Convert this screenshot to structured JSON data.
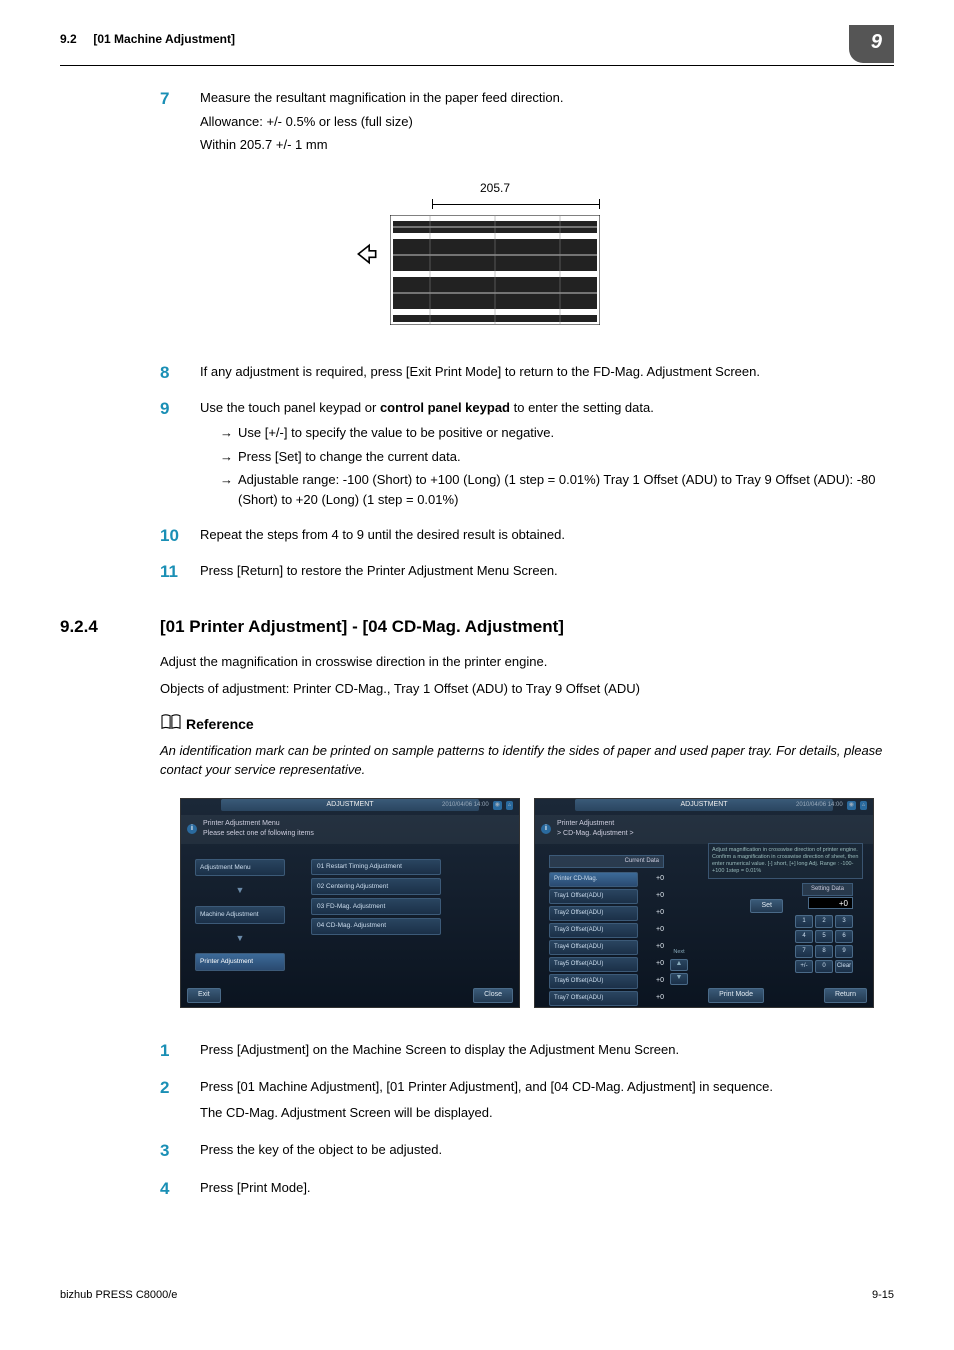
{
  "header": {
    "section": "9.2",
    "title": "[01 Machine Adjustment]",
    "chapter_badge": "9"
  },
  "steps_upper": {
    "s7": {
      "num": "7",
      "line1": "Measure the resultant magnification in the paper feed direction.",
      "line2": "Allowance: +/- 0.5% or less (full size)",
      "line3": "Within 205.7 +/- 1 mm"
    },
    "diagram_label": "205.7",
    "s8": {
      "num": "8",
      "text": "If any adjustment is required, press [Exit Print Mode] to return to the FD-Mag. Adjustment Screen."
    },
    "s9": {
      "num": "9",
      "text": "Use the touch panel keypad or ",
      "bold": "control panel keypad",
      "text2": " to enter the setting data.",
      "b1": "Use [+/-] to specify the value to be positive or negative.",
      "b2": "Press [Set] to change the current data.",
      "b3": "Adjustable range: -100 (Short) to +100 (Long) (1 step = 0.01%) Tray 1 Offset (ADU) to Tray 9 Offset (ADU): -80 (Short) to +20 (Long) (1 step = 0.01%)"
    },
    "s10": {
      "num": "10",
      "text": "Repeat the steps from 4 to 9 until the desired result is obtained."
    },
    "s11": {
      "num": "11",
      "text": "Press [Return] to restore the Printer Adjustment Menu Screen."
    }
  },
  "section924": {
    "num": "9.2.4",
    "title": "[01 Printer Adjustment] - [04 CD-Mag. Adjustment]",
    "p1": "Adjust the magnification in crosswise direction in the printer engine.",
    "p2": "Objects of adjustment: Printer CD-Mag., Tray 1 Offset (ADU) to Tray 9 Offset (ADU)",
    "ref_label": "Reference",
    "ref_text": "An identification mark can be printed on sample patterns to identify the sides of paper and used paper tray. For details, please contact your service representative."
  },
  "screen1": {
    "topbar": "ADJUSTMENT",
    "datetime": "2010/04/06 14:00",
    "header_line1": "Printer Adjustment Menu",
    "header_line2": "Please select one of following items",
    "nav1": "Adjustment Menu",
    "nav2": "Machine Adjustment",
    "nav3": "Printer Adjustment",
    "menu1": "01 Restart Timing Adjustment",
    "menu2": "02 Centering Adjustment",
    "menu3": "03 FD-Mag. Adjustment",
    "menu4": "04 CD-Mag. Adjustment",
    "exit": "Exit",
    "close": "Close"
  },
  "screen2": {
    "topbar": "ADJUSTMENT",
    "datetime": "2010/04/06 14:00",
    "header_line1": "Printer Adjustment",
    "header_line2": "> CD-Mag. Adjustment >",
    "current_data": "Current Data",
    "setting_data": "Setting Data",
    "info": "Adjust magnification in crosswise direction of printer engine. Confirm a magnification in crosswise direction of sheet, then enter numerical value.\n[-] short, [+] long\nAdj. Range : -100-+100  1step = 0.01%",
    "rows": [
      {
        "label": "Printer CD-Mag.",
        "val": "+0"
      },
      {
        "label": "Tray1 Offset(ADU)",
        "val": "+0"
      },
      {
        "label": "Tray2 Offset(ADU)",
        "val": "+0"
      },
      {
        "label": "Tray3 Offset(ADU)",
        "val": "+0"
      },
      {
        "label": "Tray4 Offset(ADU)",
        "val": "+0"
      },
      {
        "label": "Tray5 Offset(ADU)",
        "val": "+0"
      },
      {
        "label": "Tray6 Offset(ADU)",
        "val": "+0"
      },
      {
        "label": "Tray7 Offset(ADU)",
        "val": "+0"
      }
    ],
    "set": "Set",
    "display": "+0",
    "next": "Next",
    "keypad": [
      "1",
      "2",
      "3",
      "4",
      "5",
      "6",
      "7",
      "8",
      "9",
      "+/-",
      "0",
      "Clear"
    ],
    "print_mode": "Print Mode",
    "return": "Return"
  },
  "steps_lower": {
    "s1": {
      "num": "1",
      "text": "Press [Adjustment] on the Machine Screen to display the Adjustment Menu Screen."
    },
    "s2": {
      "num": "2",
      "line1": "Press [01 Machine Adjustment], [01 Printer Adjustment], and [04 CD-Mag. Adjustment] in sequence.",
      "line2": "The CD-Mag. Adjustment Screen will be displayed."
    },
    "s3": {
      "num": "3",
      "text": "Press the key of the object to be adjusted."
    },
    "s4": {
      "num": "4",
      "text": "Press [Print Mode]."
    }
  },
  "footer": {
    "left": "bizhub PRESS C8000/e",
    "right": "9-15"
  },
  "chart_data": {
    "type": "table",
    "title": "Feed direction measurement diagram",
    "measurement_mm": 205.7,
    "notes": "Schematic print pattern with 205.7 mm width dimension indicated; left arrow shows feed direction."
  }
}
